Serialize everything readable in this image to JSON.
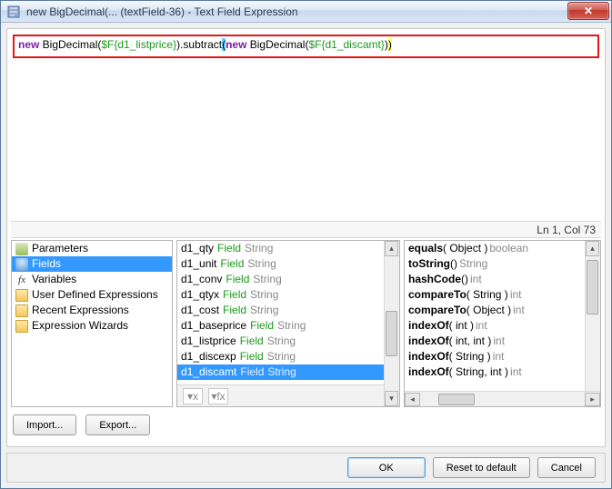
{
  "window": {
    "title": "new BigDecimal(... (textField-36) - Text Field Expression"
  },
  "editor": {
    "tokens": [
      {
        "t": "new ",
        "c": "kw"
      },
      {
        "t": "BigDecimal(",
        "c": ""
      },
      {
        "t": "$F{d1_listprice}",
        "c": "field"
      },
      {
        "t": ").subtract",
        "c": ""
      },
      {
        "t": "(",
        "c": "hl-b"
      },
      {
        "t": "new ",
        "c": "kw"
      },
      {
        "t": "BigDecimal(",
        "c": ""
      },
      {
        "t": "$F{d1_discamt}",
        "c": "field"
      },
      {
        "t": ")",
        "c": ""
      },
      {
        "t": ")",
        "c": "hl-y"
      }
    ],
    "status": "Ln 1, Col 73"
  },
  "tree": {
    "items": [
      {
        "label": "Parameters",
        "icon": "param-icon"
      },
      {
        "label": "Fields",
        "icon": "db-icon",
        "selected": true
      },
      {
        "label": "Variables",
        "icon": "fx-icon",
        "iconText": "fx"
      },
      {
        "label": "User Defined Expressions",
        "icon": "folder-icon"
      },
      {
        "label": "Recent Expressions",
        "icon": "folder-icon"
      },
      {
        "label": "Expression Wizards",
        "icon": "folder-icon"
      }
    ]
  },
  "fields": [
    {
      "name": "d1_qty",
      "type": "Field",
      "cls": "String"
    },
    {
      "name": "d1_unit",
      "type": "Field",
      "cls": "String"
    },
    {
      "name": "d1_conv",
      "type": "Field",
      "cls": "String"
    },
    {
      "name": "d1_qtyx",
      "type": "Field",
      "cls": "String"
    },
    {
      "name": "d1_cost",
      "type": "Field",
      "cls": "String"
    },
    {
      "name": "d1_baseprice",
      "type": "Field",
      "cls": "String"
    },
    {
      "name": "d1_listprice",
      "type": "Field",
      "cls": "String"
    },
    {
      "name": "d1_discexp",
      "type": "Field",
      "cls": "String"
    },
    {
      "name": "d1_discamt",
      "type": "Field",
      "cls": "String",
      "selected": true
    }
  ],
  "methods": [
    {
      "name": "equals",
      "args": "( Object )",
      "ret": "boolean"
    },
    {
      "name": "toString",
      "args": "()",
      "ret": "String"
    },
    {
      "name": "hashCode",
      "args": "()",
      "ret": "int"
    },
    {
      "name": "compareTo",
      "args": "( String )",
      "ret": "int"
    },
    {
      "name": "compareTo",
      "args": "( Object )",
      "ret": "int"
    },
    {
      "name": "indexOf",
      "args": "( int )",
      "ret": "int"
    },
    {
      "name": "indexOf",
      "args": "( int, int )",
      "ret": "int"
    },
    {
      "name": "indexOf",
      "args": "( String )",
      "ret": "int"
    },
    {
      "name": "indexOf",
      "args": "( String, int )",
      "ret": "int"
    }
  ],
  "buttons": {
    "import": "Import...",
    "export": "Export...",
    "ok": "OK",
    "reset": "Reset to default",
    "cancel": "Cancel"
  }
}
